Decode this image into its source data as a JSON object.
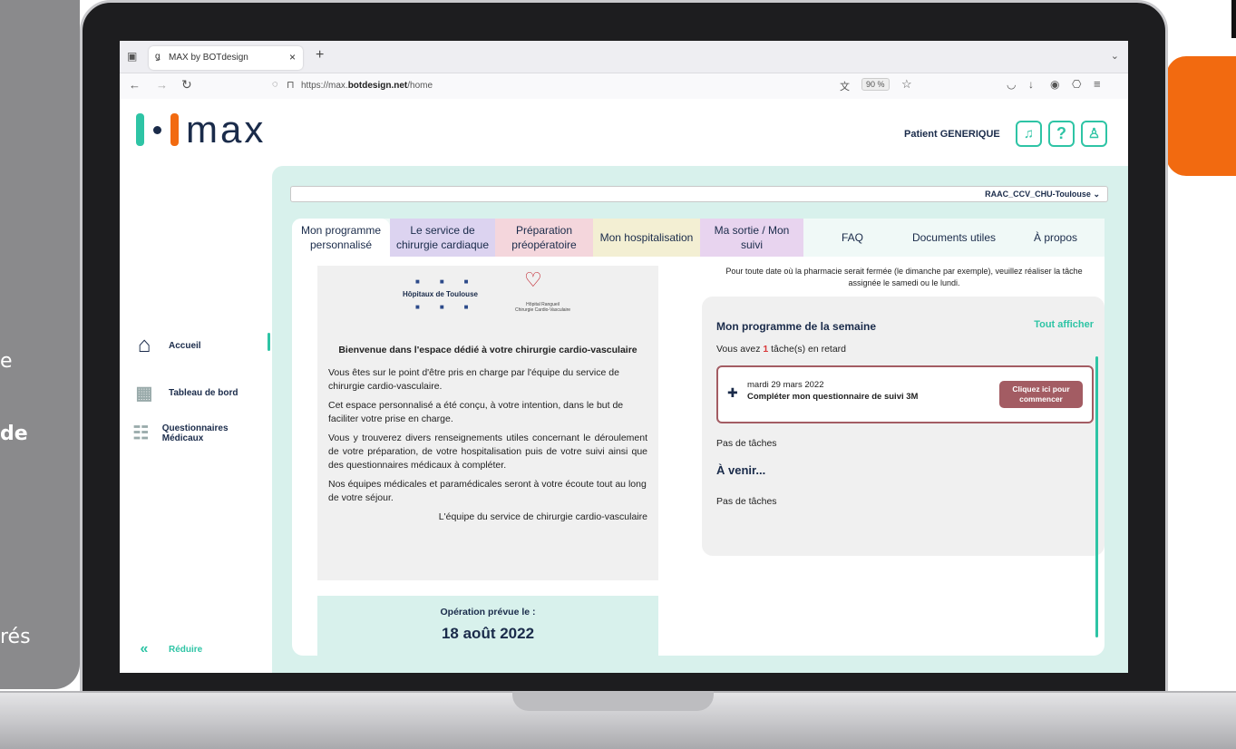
{
  "left_panel": {
    "lines": [
      "e",
      "de",
      "rés"
    ]
  },
  "browser": {
    "tab_title": "MAX by BOTdesign",
    "new_tab": "+",
    "url_prefix": "https://max.",
    "url_domain": "botdesign.net",
    "url_path": "/home",
    "zoom": "90 %"
  },
  "header": {
    "logo_text": "max",
    "patient_name": "Patient GENERIQUE",
    "help_label": "?"
  },
  "sidebar": {
    "items": [
      {
        "label": "Accueil"
      },
      {
        "label": "Tableau de bord"
      },
      {
        "label": "Questionnaires Médicaux"
      }
    ],
    "collapse_label": "Réduire",
    "collapse_glyph": "«"
  },
  "select": {
    "value": "RAAC_CCV_CHU-Toulouse"
  },
  "tabs": [
    {
      "label": "Mon programme personnalisé",
      "color": "#ffffff"
    },
    {
      "label": "Le service de chirurgie cardiaque",
      "color": "#dcd3f0"
    },
    {
      "label": "Préparation préopératoire",
      "color": "#f4d6dc"
    },
    {
      "label": "Mon hospitalisation",
      "color": "#f3efd3"
    },
    {
      "label": "Ma sortie / Mon suivi",
      "color": "#e8d4ef"
    },
    {
      "label": "FAQ",
      "color": "#f0f9f7"
    },
    {
      "label": "Documents utiles",
      "color": "#f0f9f7"
    },
    {
      "label": "À propos",
      "color": "#f0f9f7"
    }
  ],
  "welcome": {
    "logo1": "Hôpitaux de Toulouse",
    "logo2_line1": "Hôpital Rangueil",
    "logo2_line2": "Chirurgie Cardio-Vasculaire",
    "title": "Bienvenue dans l'espace dédié à votre chirurgie cardio-vasculaire",
    "paragraphs": [
      "Vous êtes sur le point d'être pris en charge par l'équipe du service de chirurgie cardio-vasculaire.",
      "Cet espace personnalisé a été conçu, à votre intention, dans le but de faciliter votre prise en charge.",
      "Vous y trouverez divers renseignements utiles concernant le déroulement de votre préparation, de votre hospitalisation puis de votre suivi ainsi que des questionnaires médicaux à compléter.",
      "Nos équipes médicales et paramédicales seront à votre écoute tout au long de votre séjour."
    ],
    "signature": "L'équipe du service de chirurgie cardio-vasculaire"
  },
  "operation": {
    "label": "Opération prévue le :",
    "date": "18 août 2022"
  },
  "note": "Pour toute date où la pharmacie serait fermée (le dimanche par exemple), veuillez réaliser la tâche assignée le samedi ou le lundi.",
  "program": {
    "title": "Mon programme de la semaine",
    "show_all": "Tout afficher",
    "late_prefix": "Vous avez ",
    "late_count": "1",
    "late_suffix": " tâche(s) en retard",
    "task": {
      "date": "mardi 29 mars 2022",
      "name": "Compléter mon questionnaire de suivi 3M",
      "button": "Cliquez ici pour commencer"
    },
    "no_tasks_1": "Pas de tâches",
    "upcoming_title": "À venir...",
    "no_tasks_2": "Pas de tâches"
  },
  "colors": {
    "teal": "#2ec4a5",
    "orange": "#f26a10",
    "navy": "#1a2b4a",
    "late_red": "#d9383a",
    "task_border": "#a35c63"
  }
}
